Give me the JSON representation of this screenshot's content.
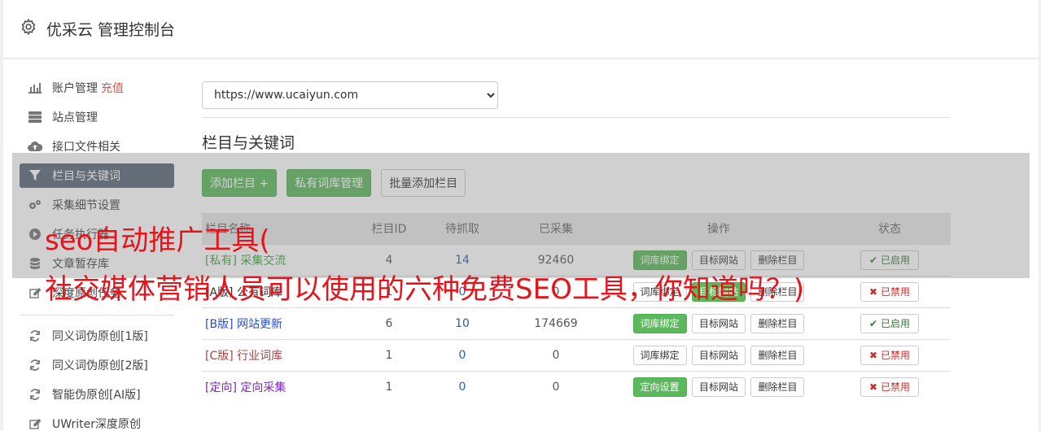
{
  "app": {
    "title": "优采云 管理控制台"
  },
  "sidebar": {
    "items": [
      {
        "label": "账户管理",
        "extra": "充值",
        "icon": "bar-chart-icon"
      },
      {
        "label": "站点管理",
        "icon": "server-icon"
      },
      {
        "label": "接口文件相关",
        "icon": "cloud-upload-icon"
      },
      {
        "label": "栏目与关键词",
        "icon": "filter-icon",
        "active": true
      },
      {
        "label": "采集细节设置",
        "icon": "cogs-icon"
      },
      {
        "label": "任务执行器",
        "icon": "play-icon"
      },
      {
        "label": "文章暂存库",
        "icon": "database-icon"
      },
      {
        "label": "深度原创任务",
        "icon": "edit-icon"
      }
    ],
    "items2": [
      {
        "label": "同义词伪原创[1版]",
        "icon": "refresh-icon"
      },
      {
        "label": "同义词伪原创[2版]",
        "icon": "refresh-icon"
      },
      {
        "label": "智能伪原创[AI版]",
        "icon": "refresh-icon"
      },
      {
        "label": "UWriter深度原创",
        "icon": "edit-icon"
      }
    ]
  },
  "site_select": {
    "value": "https://www.ucaiyun.com"
  },
  "section": {
    "title": "栏目与关键词"
  },
  "buttons": {
    "add_column": "添加栏目 +",
    "private_lib": "私有词库管理",
    "batch_add": "批量添加栏目"
  },
  "table": {
    "headers": [
      "栏目名称",
      "栏目ID",
      "待抓取",
      "已采集",
      "操作",
      "状态"
    ],
    "rows": [
      {
        "tag": "[私有]",
        "name": "采集交流",
        "id": "4",
        "pending": "14",
        "collected": "92460",
        "op1": "词库绑定",
        "op2": "目标网站",
        "op3": "删除栏目",
        "status": "已启用"
      },
      {
        "tag": "[A版]",
        "name": "公有词库",
        "id": "1",
        "pending": "0",
        "collected": "0",
        "op1": "词库绑定",
        "op2": "目标网站",
        "op3": "删除栏目",
        "status": "已禁用"
      },
      {
        "tag": "[B版]",
        "name": "网站更新",
        "id": "6",
        "pending": "10",
        "collected": "174669",
        "op1": "词库绑定",
        "op2": "目标网站",
        "op3": "删除栏目",
        "status": "已启用"
      },
      {
        "tag": "[C版]",
        "name": "行业词库",
        "id": "1",
        "pending": "0",
        "collected": "0",
        "op1": "词库绑定",
        "op2": "目标网站",
        "op3": "删除栏目",
        "status": "已禁用"
      },
      {
        "tag": "[定向]",
        "name": "定向采集",
        "id": "1",
        "pending": "0",
        "collected": "0",
        "op1": "定向设置",
        "op2": "目标网站",
        "op3": "删除栏目",
        "status": "已禁用"
      }
    ]
  },
  "overlay": {
    "line1": "seo自动推广工具(",
    "line2": "社交媒体营销人员可以使用的六种免费SEO工具，你知道吗？)"
  },
  "colors": {
    "green": "#5cb85c",
    "active": "#5b6878",
    "overlay_text": "#e8121a"
  }
}
